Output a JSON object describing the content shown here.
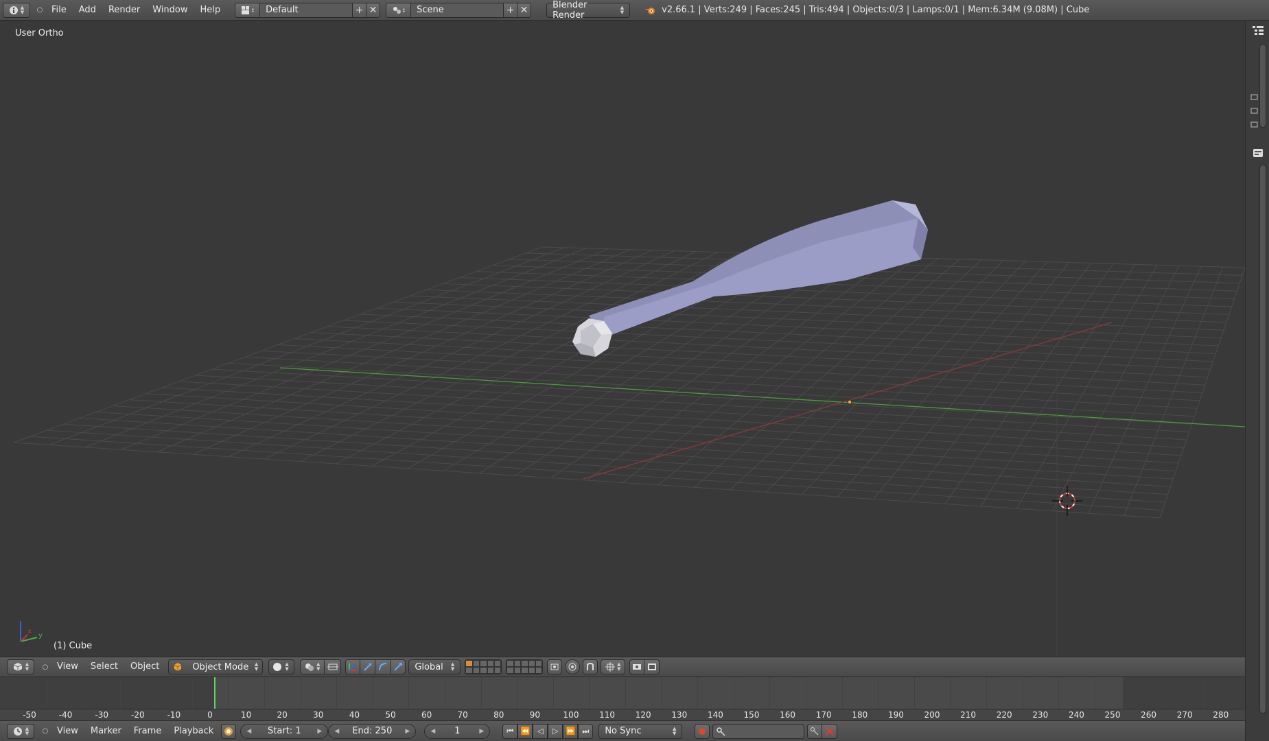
{
  "topbar": {
    "menus": [
      "File",
      "Add",
      "Render",
      "Window",
      "Help"
    ],
    "screen_layout": "Default",
    "scene": "Scene",
    "render_engine": "Blender Render",
    "stats": "v2.66.1 | Verts:249 | Faces:245 | Tris:494 | Objects:0/3 | Lamps:0/1 | Mem:6.34M (9.08M) | Cube"
  },
  "viewport": {
    "view_label": "User Ortho",
    "object_label": "(1) Cube",
    "axis_labels": {
      "x": "x",
      "y": "y",
      "z": "z"
    }
  },
  "view3d_header": {
    "menus": [
      "View",
      "Select",
      "Object"
    ],
    "mode": "Object Mode",
    "orientation": "Global"
  },
  "timeline": {
    "ticks": [
      "-50",
      "-40",
      "-30",
      "-20",
      "-10",
      "0",
      "10",
      "20",
      "30",
      "40",
      "50",
      "60",
      "70",
      "80",
      "90",
      "100",
      "110",
      "120",
      "130",
      "140",
      "150",
      "160",
      "170",
      "180",
      "190",
      "200",
      "210",
      "220",
      "230",
      "240",
      "250",
      "260",
      "270",
      "280"
    ],
    "current_frame_marker": 0
  },
  "timeline_header": {
    "menus": [
      "View",
      "Marker",
      "Frame",
      "Playback"
    ],
    "start": "Start: 1",
    "end": "End: 250",
    "current": "1",
    "sync": "No Sync"
  },
  "colors": {
    "background": "#393939",
    "x_axis": "#8b3a3a",
    "y_axis": "#4a9d3a",
    "mesh": "#9a9bc0",
    "timeline_cursor": "#5fd35f"
  }
}
